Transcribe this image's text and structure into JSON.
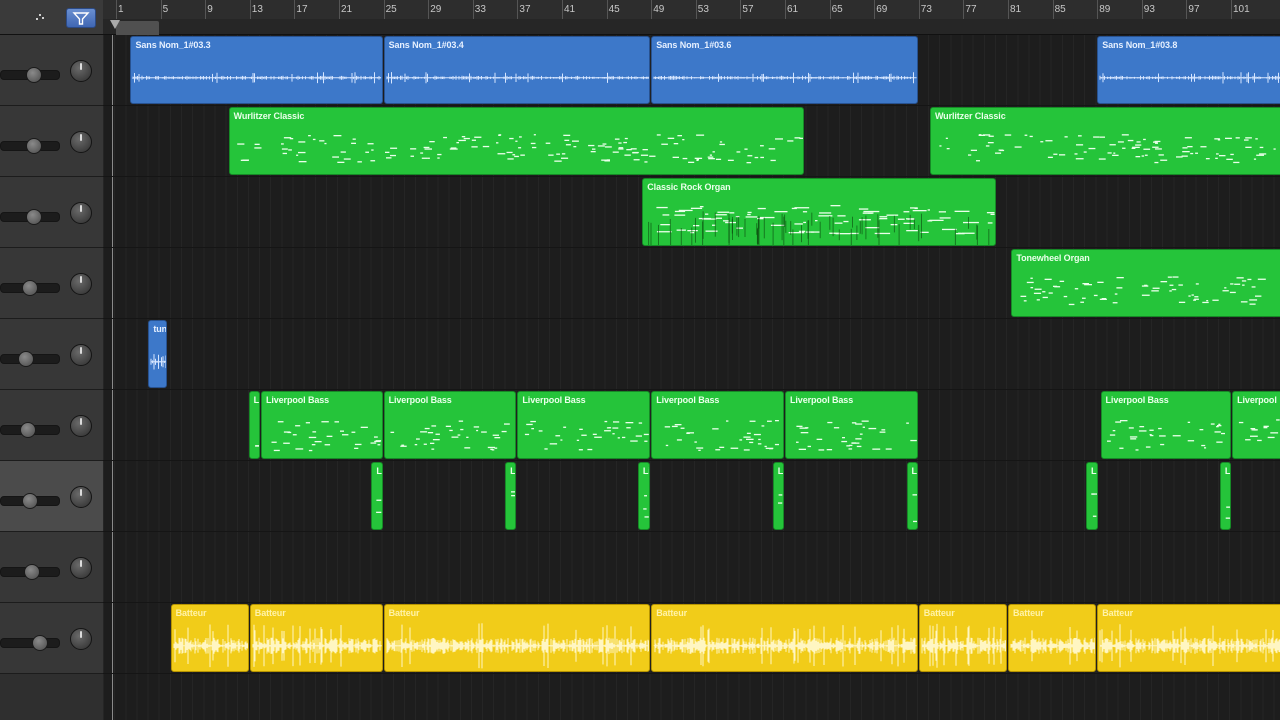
{
  "ruler": {
    "bars": [
      "1",
      "5",
      "9",
      "13",
      "17",
      "21",
      "25",
      "29",
      "33",
      "37",
      "41",
      "45",
      "49",
      "53",
      "57",
      "61",
      "65",
      "69",
      "73",
      "77",
      "81",
      "85",
      "89",
      "93",
      "97",
      "101"
    ]
  },
  "header": {
    "tool_icon": "pointer-icon",
    "filter_icon": "filter-icon"
  },
  "colors": {
    "audio_region": "#3d78c9",
    "midi_region": "#25c43a",
    "drum_region": "#f1cc19",
    "track_header": "#373737",
    "selected_track_header": "#4b4b4b",
    "background": "#1b1b1b"
  },
  "tracks": [
    {
      "id": 1,
      "type": "audio",
      "volume": 0.55,
      "pan": 0.5,
      "selected": false
    },
    {
      "id": 2,
      "type": "midi",
      "volume": 0.55,
      "pan": 0.5,
      "selected": false
    },
    {
      "id": 3,
      "type": "midi",
      "volume": 0.55,
      "pan": 0.5,
      "selected": false
    },
    {
      "id": 4,
      "type": "midi",
      "volume": 0.48,
      "pan": 0.5,
      "selected": false
    },
    {
      "id": 5,
      "type": "audio",
      "volume": 0.42,
      "pan": 0.5,
      "selected": false
    },
    {
      "id": 6,
      "type": "midi",
      "volume": 0.45,
      "pan": 0.5,
      "selected": false
    },
    {
      "id": 7,
      "type": "midi",
      "volume": 0.48,
      "pan": 0.5,
      "selected": true
    },
    {
      "id": 8,
      "type": "midi",
      "volume": 0.52,
      "pan": 0.5,
      "selected": false
    },
    {
      "id": 9,
      "type": "drum",
      "volume": 0.65,
      "pan": 0.5,
      "selected": false
    }
  ],
  "regions": [
    {
      "track": 1,
      "type": "audio",
      "name": "Sans Nom_1#03.3",
      "start": 2.3,
      "end": 25
    },
    {
      "track": 1,
      "type": "audio",
      "name": "Sans Nom_1#03.4",
      "start": 25,
      "end": 49
    },
    {
      "track": 1,
      "type": "audio",
      "name": "Sans Nom_1#03.6",
      "start": 49,
      "end": 73
    },
    {
      "track": 1,
      "type": "audio",
      "name": "Sans Nom_1#03.8",
      "start": 89,
      "end": 106
    },
    {
      "track": 2,
      "type": "midi",
      "name": "Wurlitzer Classic",
      "start": 11.1,
      "end": 62.8
    },
    {
      "track": 2,
      "type": "midi",
      "name": "Wurlitzer Classic",
      "start": 74,
      "end": 106
    },
    {
      "track": 3,
      "type": "midi",
      "name": "Classic Rock Organ",
      "start": 48.2,
      "end": 80
    },
    {
      "track": 4,
      "type": "midi",
      "name": "Tonewheel Organ",
      "start": 81.3,
      "end": 106
    },
    {
      "track": 5,
      "type": "audio",
      "name": "tuni",
      "start": 3.9,
      "end": 5.7
    },
    {
      "track": 6,
      "type": "midi",
      "name": "Li",
      "start": 12.9,
      "end": 14
    },
    {
      "track": 6,
      "type": "midi",
      "name": "Liverpool Bass",
      "start": 14,
      "end": 25
    },
    {
      "track": 6,
      "type": "midi",
      "name": "Liverpool Bass",
      "start": 25,
      "end": 37
    },
    {
      "track": 6,
      "type": "midi",
      "name": "Liverpool Bass",
      "start": 37,
      "end": 49
    },
    {
      "track": 6,
      "type": "midi",
      "name": "Liverpool Bass",
      "start": 49,
      "end": 61
    },
    {
      "track": 6,
      "type": "midi",
      "name": "Liverpool Bass",
      "start": 61,
      "end": 73
    },
    {
      "track": 6,
      "type": "midi",
      "name": "Liverpool Bass",
      "start": 89.3,
      "end": 101.1
    },
    {
      "track": 6,
      "type": "midi",
      "name": "Liverpool",
      "start": 101.1,
      "end": 106
    },
    {
      "track": 7,
      "type": "midi",
      "name": "Li",
      "start": 23.9,
      "end": 25
    },
    {
      "track": 7,
      "type": "midi",
      "name": "Li",
      "start": 35.9,
      "end": 37
    },
    {
      "track": 7,
      "type": "midi",
      "name": "Li",
      "start": 47.8,
      "end": 49
    },
    {
      "track": 7,
      "type": "midi",
      "name": "Li",
      "start": 59.9,
      "end": 61
    },
    {
      "track": 7,
      "type": "midi",
      "name": "Li",
      "start": 71.9,
      "end": 73
    },
    {
      "track": 7,
      "type": "midi",
      "name": "Li",
      "start": 88,
      "end": 89.2
    },
    {
      "track": 7,
      "type": "midi",
      "name": "Li",
      "start": 100,
      "end": 101.1
    },
    {
      "track": 9,
      "type": "drum",
      "name": "Batteur",
      "start": 5.9,
      "end": 13
    },
    {
      "track": 9,
      "type": "drum",
      "name": "Batteur",
      "start": 13,
      "end": 25
    },
    {
      "track": 9,
      "type": "drum",
      "name": "Batteur",
      "start": 25,
      "end": 49
    },
    {
      "track": 9,
      "type": "drum",
      "name": "Batteur",
      "start": 49,
      "end": 73
    },
    {
      "track": 9,
      "type": "drum",
      "name": "Batteur",
      "start": 73,
      "end": 81
    },
    {
      "track": 9,
      "type": "drum",
      "name": "Batteur",
      "start": 81,
      "end": 89
    },
    {
      "track": 9,
      "type": "drum",
      "name": "Batteur",
      "start": 89,
      "end": 106
    }
  ]
}
